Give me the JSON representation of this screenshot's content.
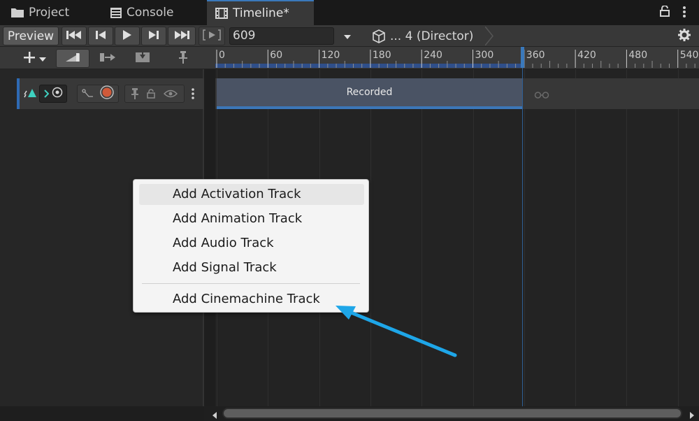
{
  "tabs": [
    {
      "label": "Project",
      "icon": "folder-icon"
    },
    {
      "label": "Console",
      "icon": "console-icon"
    },
    {
      "label": "Timeline*",
      "icon": "timeline-film-icon"
    }
  ],
  "toolbar": {
    "preview_label": "Preview",
    "frame_value": "609",
    "director_label": "... 4 (Director)"
  },
  "ruler": {
    "labels": [
      "0",
      "60",
      "120",
      "180",
      "240",
      "300",
      "360",
      "420",
      "480",
      "540"
    ]
  },
  "track": {
    "clip_label": "Recorded"
  },
  "context_menu": {
    "items": [
      "Add Activation Track",
      "Add Animation Track",
      "Add Audio Track",
      "Add Signal Track",
      "Add Cinemachine Track"
    ],
    "hover_index": 0
  },
  "colors": {
    "accent": "#3a79bb",
    "annotation_arrow": "#1ea6e8",
    "record": "#d05a3a"
  }
}
